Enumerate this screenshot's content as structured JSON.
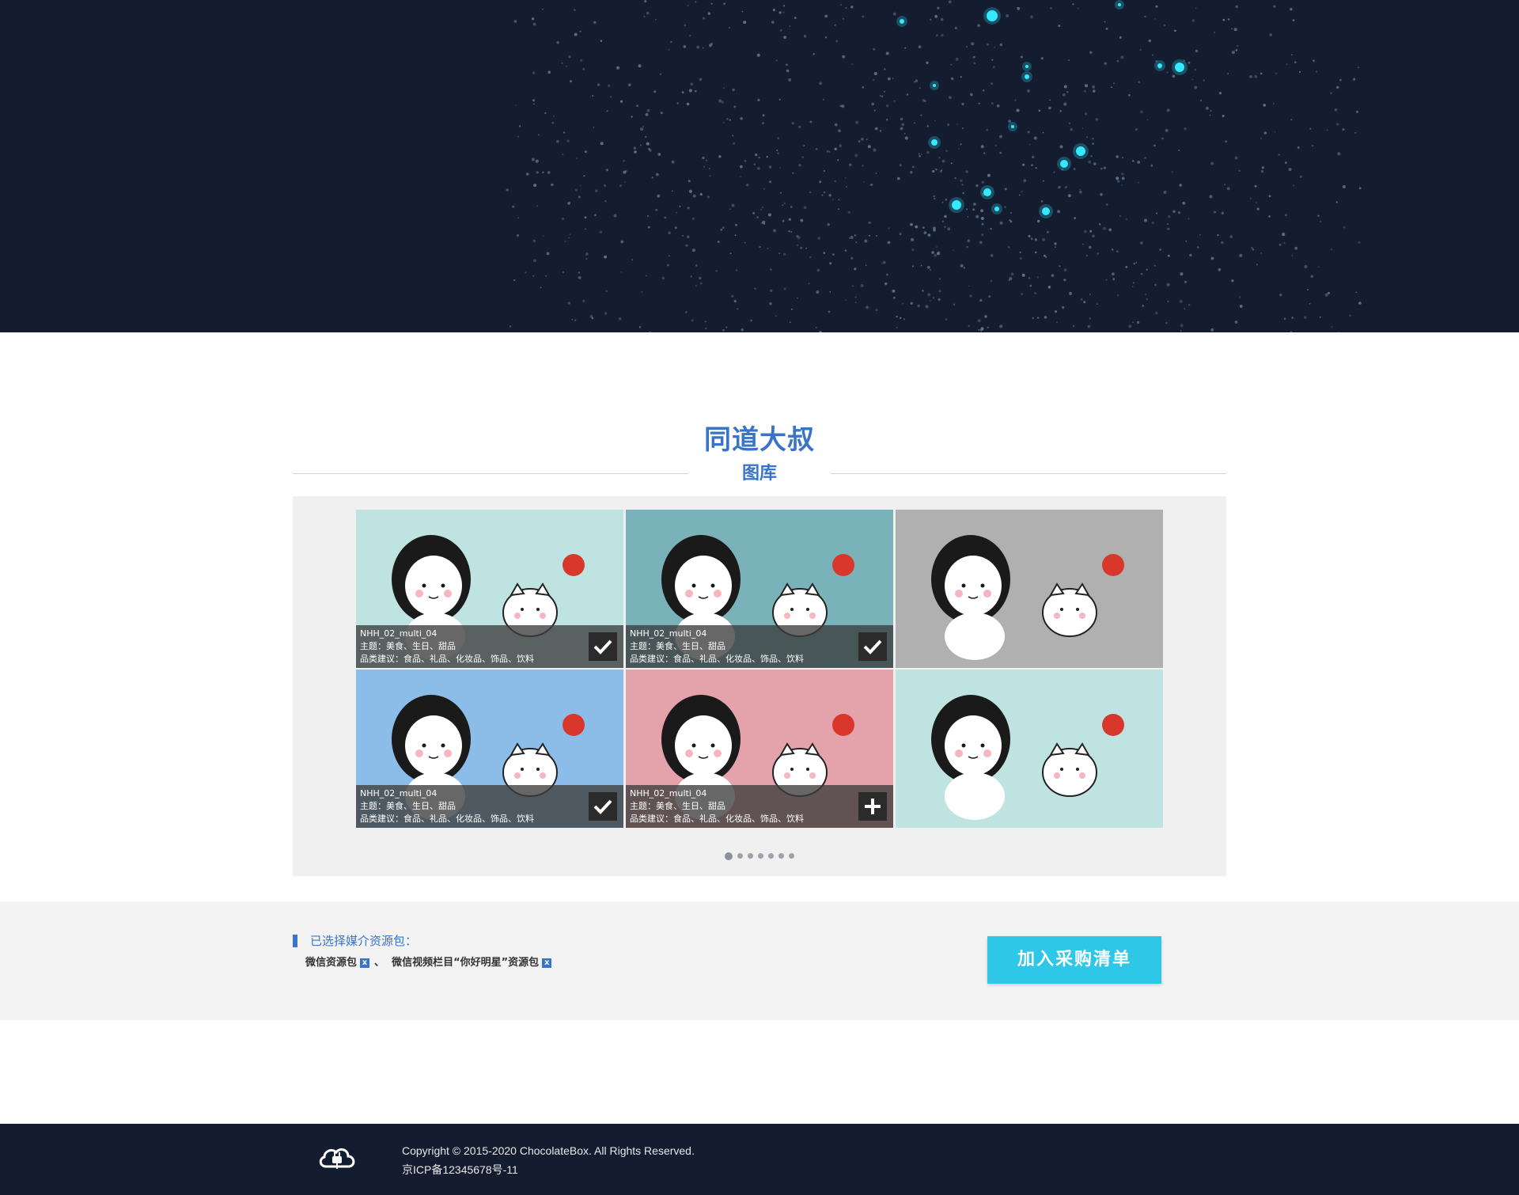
{
  "gallery_header": {
    "title": "同道大叔",
    "subtitle": "图库"
  },
  "tiles": [
    {
      "name": "NHH_02_multi_04",
      "theme": "主题：美食、生日、甜品",
      "suggest": "品类建议：食品、礼品、化妆品、饰品、饮料",
      "state": "selected",
      "icon": "check-icon",
      "bg": "#bfe3e1",
      "captioned": true
    },
    {
      "name": "NHH_02_multi_04",
      "theme": "主题：美食、生日、甜品",
      "suggest": "品类建议：食品、礼品、化妆品、饰品、饮料",
      "state": "selected",
      "icon": "check-icon",
      "bg": "#79b2b8",
      "captioned": true
    },
    {
      "bg": "#b0b0b0",
      "captioned": false
    },
    {
      "name": "NHH_02_multi_04",
      "theme": "主题：美食、生日、甜品",
      "suggest": "品类建议：食品、礼品、化妆品、饰品、饮料",
      "state": "selected",
      "icon": "check-icon",
      "bg": "#8cbde8",
      "captioned": true
    },
    {
      "name": "NHH_02_multi_04",
      "theme": "主题：美食、生日、甜品",
      "suggest": "品类建议：食品、礼品、化妆品、饰品、饮料",
      "state": "unselected",
      "icon": "plus-icon",
      "bg": "#e4a2aa",
      "captioned": true
    },
    {
      "bg": "#bfe3e1",
      "captioned": false
    }
  ],
  "pagination": {
    "pages": 7,
    "current": 1
  },
  "selection": {
    "label": "已选择媒介资源包：",
    "items": [
      "微信资源包",
      "微信视频栏目“你好明星”资源包"
    ],
    "separator": "、",
    "remove_glyph": "x"
  },
  "cart_button": {
    "label": "加入采购清单"
  },
  "footer": {
    "copyright": "Copyright © 2015-2020 ChocolateBox. All Rights Reserved.",
    "icp": "京ICP备12345678号-11"
  },
  "colors": {
    "accent": "#3a74c8",
    "cart": "#2ec7e8",
    "dark": "#141c2f"
  }
}
